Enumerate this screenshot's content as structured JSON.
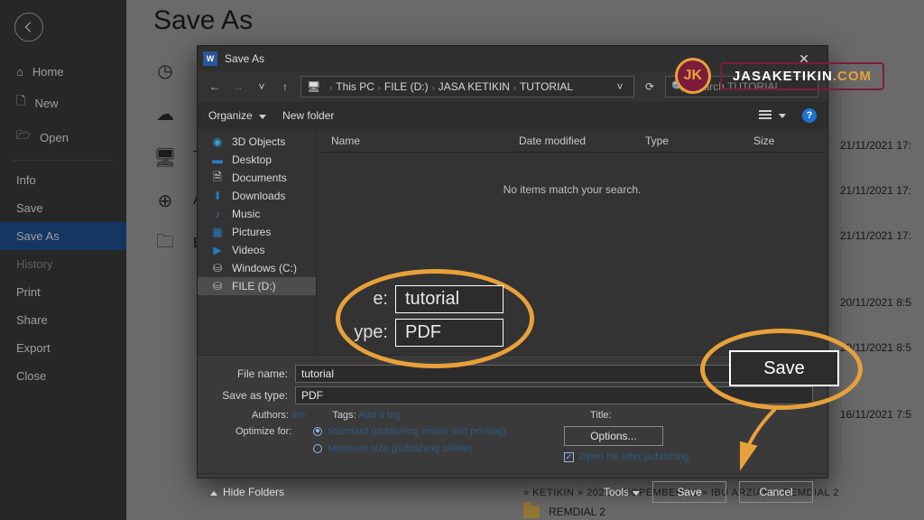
{
  "backstage": {
    "title": "Save As",
    "nav": {
      "home": "Home",
      "new": "New",
      "open": "Open",
      "info": "Info",
      "save": "Save",
      "save_as": "Save As",
      "history": "History",
      "print": "Print",
      "share": "Share",
      "export": "Export",
      "close": "Close"
    },
    "dates": {
      "d1": "21/11/2021 17:",
      "d2": "21/11/2021 17:",
      "d3": "21/11/2021 17:",
      "d4": "20/11/2021 8:5",
      "d5": "20/11/2021 8:5",
      "d6": "16/11/2021 7:5"
    },
    "recent_folder": "REMDIAL 2",
    "recent_path": "» KETIKIN » 2021 » NOPEMBER 21 » IBU ARZIAH » REMDIAL 2"
  },
  "dialog": {
    "title": "Save As",
    "breadcrumb": {
      "root": "This PC",
      "p1": "FILE (D:)",
      "p2": "JASA KETIKIN",
      "p3": "TUTORIAL"
    },
    "search_placeholder": "Search TUTORIAL",
    "toolbar": {
      "organize": "Organize",
      "new_folder": "New folder"
    },
    "tree": {
      "objects3d": "3D Objects",
      "desktop": "Desktop",
      "documents": "Documents",
      "downloads": "Downloads",
      "music": "Music",
      "pictures": "Pictures",
      "videos": "Videos",
      "windows_c": "Windows (C:)",
      "file_d": "FILE (D:)"
    },
    "columns": {
      "name": "Name",
      "date": "Date modified",
      "type": "Type",
      "size": "Size"
    },
    "empty": "No items match your search.",
    "file_name_label": "File name:",
    "file_name_value": "tutorial",
    "save_type_label": "Save as type:",
    "save_type_value": "PDF",
    "meta": {
      "authors_k": "Authors:",
      "authors_v": "am",
      "tags_k": "Tags:",
      "tags_v": "Add a tag",
      "title_k": "Title:",
      "title_v": ""
    },
    "optimize_label": "Optimize for:",
    "opt_standard": "Standard (publishing online and printing)",
    "opt_min": "Minimum size (publishing online)",
    "options_btn": "Options...",
    "open_after": "Open file after publishing",
    "hide_folders": "Hide Folders",
    "tools": "Tools",
    "save": "Save",
    "cancel": "Cancel"
  },
  "annotation": {
    "name_label": "e:",
    "name_value": "tutorial",
    "type_label": "ype:",
    "type_value": "PDF",
    "save": "Save"
  },
  "watermark": {
    "badge": "JK",
    "text_a": "JASAKETIKIN",
    "text_b": ".COM"
  }
}
